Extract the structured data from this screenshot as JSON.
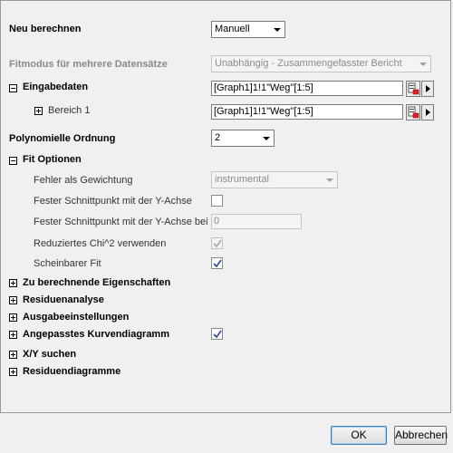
{
  "rows": {
    "neu_berechnen": {
      "label": "Neu berechnen",
      "value": "Manuell"
    },
    "fitmodus": {
      "label": "Fitmodus für mehrere Datensätze",
      "value": "Unabhängig - Zusammengefasster Bericht"
    },
    "eingabedaten": {
      "label": "Eingabedaten",
      "value": "[Graph1]1!1\"Weg\"[1:5]"
    },
    "bereich1": {
      "label": "Bereich 1",
      "value": "[Graph1]1!1\"Weg\"[1:5]"
    },
    "polynom": {
      "label": "Polynomielle Ordnung",
      "value": "2"
    },
    "fit_optionen": {
      "label": "Fit Optionen"
    },
    "fehler": {
      "label": "Fehler als Gewichtung",
      "value": "instrumental"
    },
    "fester_schnitt": {
      "label": "Fester Schnittpunkt mit der Y-Achse",
      "checked": false
    },
    "fester_schnitt_bei": {
      "label": "Fester Schnittpunkt mit der Y-Achse bei",
      "value": "0"
    },
    "chi2": {
      "label": "Reduziertes Chi^2 verwenden",
      "checked": true
    },
    "scheinbarer": {
      "label": "Scheinbarer Fit",
      "checked": true
    },
    "zu_berechnende": {
      "label": "Zu berechnende Eigenschaften"
    },
    "residuenanalyse": {
      "label": "Residuenanalyse"
    },
    "ausgabe": {
      "label": "Ausgabeeinstellungen"
    },
    "angepasstes": {
      "label": "Angepasstes Kurvendiagramm",
      "checked": true
    },
    "xy_suchen": {
      "label": "X/Y suchen"
    },
    "residuendiagramme": {
      "label": "Residuendiagramme"
    }
  },
  "buttons": {
    "ok": "OK",
    "cancel": "Abbrechen"
  },
  "colors": {
    "accent": "#3c7fb1",
    "check": "#1f4f8a"
  }
}
